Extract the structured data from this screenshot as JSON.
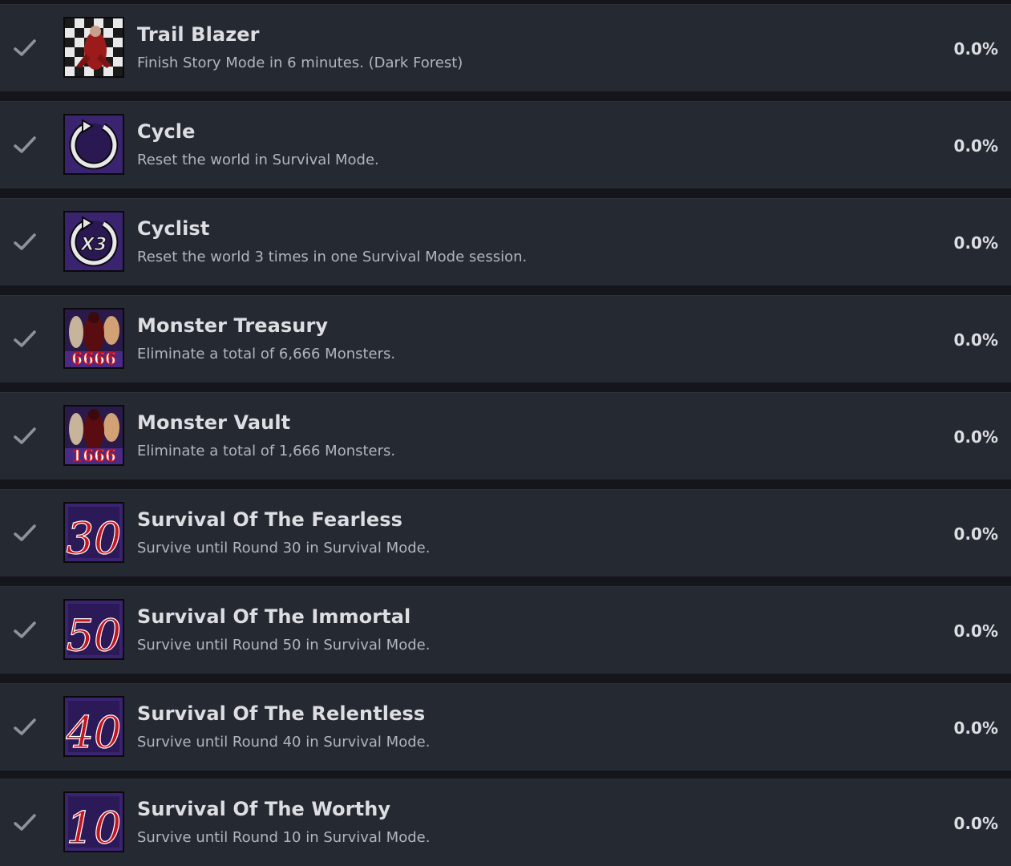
{
  "colors": {
    "page_bg": "#14161c",
    "row_bg": "#252932",
    "title": "#dcdee2",
    "description": "#b1b5bc",
    "check": "#8e939b",
    "badge_purple": "#3a2470",
    "badge_red": "#c4141e"
  },
  "achievements": [
    {
      "title": "Trail Blazer",
      "description": "Finish Story Mode in 6 minutes. (Dark Forest)",
      "percent": "0.0%",
      "icon": "trail-blazer-icon"
    },
    {
      "title": "Cycle",
      "description": "Reset the world in Survival Mode.",
      "percent": "0.0%",
      "icon": "cycle-arrow-icon"
    },
    {
      "title": "Cyclist",
      "description": "Reset the world 3 times in one Survival Mode session.",
      "percent": "0.0%",
      "icon": "cycle-x3-icon",
      "icon_text": "X3"
    },
    {
      "title": "Monster Treasury",
      "description": "Eliminate a total of 6,666 Monsters.",
      "percent": "0.0%",
      "icon": "monsters-6666-icon",
      "icon_text": "6666"
    },
    {
      "title": "Monster Vault",
      "description": "Eliminate a total of 1,666 Monsters.",
      "percent": "0.0%",
      "icon": "monsters-1666-icon",
      "icon_text": "1666"
    },
    {
      "title": "Survival Of The Fearless",
      "description": "Survive until Round 30 in Survival Mode.",
      "percent": "0.0%",
      "icon": "round-30-icon",
      "icon_text": "30"
    },
    {
      "title": "Survival Of The Immortal",
      "description": "Survive until Round 50 in Survival Mode.",
      "percent": "0.0%",
      "icon": "round-50-icon",
      "icon_text": "50"
    },
    {
      "title": "Survival Of The Relentless",
      "description": "Survive until Round 40 in Survival Mode.",
      "percent": "0.0%",
      "icon": "round-40-icon",
      "icon_text": "40"
    },
    {
      "title": "Survival Of The Worthy",
      "description": "Survive until Round 10 in Survival Mode.",
      "percent": "0.0%",
      "icon": "round-10-icon",
      "icon_text": "10"
    }
  ]
}
